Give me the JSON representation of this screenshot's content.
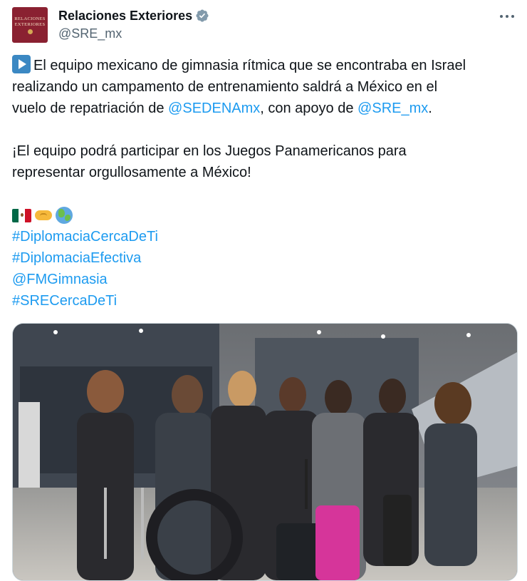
{
  "author": {
    "display_name": "Relaciones Exteriores",
    "handle": "@SRE_mx",
    "avatar_text": [
      "RELACIONES",
      "EXTERIORES"
    ],
    "avatar_color": "#8a2131",
    "verified_color": "#829aab"
  },
  "tweet": {
    "p1_pre": "El equipo mexicano de gimnasia rítmica que se encontraba en Israel",
    "p1_line2": "realizando un campamento de entrenamiento saldrá a México en el",
    "p1_line3_pre": "vuelo de repatriación de ",
    "mention1": "@SEDENAmx",
    "p1_line3_mid": ", con apoyo de ",
    "mention2": "@SRE_mx",
    "p1_line3_end": ".",
    "p2_line1": "¡El equipo podrá participar en los Juegos Panamericanos para",
    "p2_line2": "representar orgullosamente a México!",
    "emojis": [
      "mexico-flag-icon",
      "handshake-icon",
      "globe-icon"
    ],
    "tags": [
      "#DiplomaciaCercaDeTi",
      "#DiplomaciaEfectiva",
      "@FMGimnasia",
      "#SRECercaDeTi"
    ]
  },
  "colors": {
    "link": "#1d9bf0",
    "text": "#0f1419",
    "secondary": "#536471"
  }
}
